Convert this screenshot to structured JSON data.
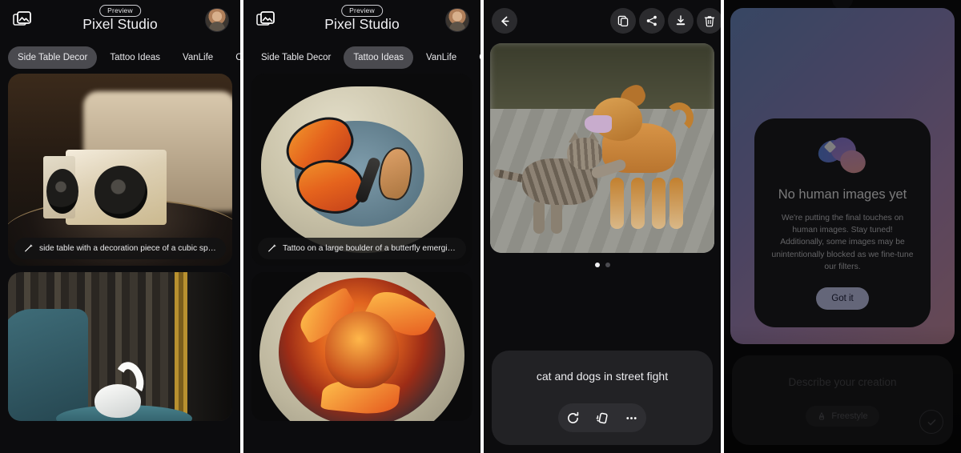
{
  "app": {
    "title": "Pixel Studio",
    "badge": "Preview",
    "gallery_icon": "gallery-folder-icon",
    "avatar": "user-avatar"
  },
  "tabs": [
    {
      "label": "Side Table Decor"
    },
    {
      "label": "Tattoo Ideas"
    },
    {
      "label": "VanLife"
    },
    {
      "label": "Cinema"
    }
  ],
  "panels": {
    "feed_side_table": {
      "active_tab": "Side Table Decor",
      "cards": [
        {
          "caption": "side table with a decoration piece of a cubic sp…",
          "icon": "magic-wand-icon"
        },
        {
          "caption": "",
          "icon": ""
        }
      ]
    },
    "feed_tattoo": {
      "active_tab": "Tattoo Ideas",
      "cards": [
        {
          "caption": "Tattoo on a large boulder of a butterfly emergin…",
          "icon": "magic-wand-icon"
        },
        {
          "caption": "",
          "icon": ""
        }
      ]
    },
    "detail": {
      "back_icon": "back-arrow-icon",
      "actions": [
        {
          "name": "copy-icon"
        },
        {
          "name": "share-icon"
        },
        {
          "name": "download-icon"
        },
        {
          "name": "delete-icon"
        }
      ],
      "pager": {
        "count": 2,
        "active": 0
      },
      "prompt": "cat and dogs in street fight",
      "prompt_actions": [
        {
          "name": "regenerate-icon"
        },
        {
          "name": "style-variation-icon"
        },
        {
          "name": "more-options-icon"
        }
      ]
    },
    "dialog_panel": {
      "dialog": {
        "logo": "pixel-studio-logo",
        "title": "No human images yet",
        "body": "We're putting the final touches on human images. Stay tuned! Additionally, some images may be unintentionally blocked as we fine-tune our filters.",
        "button": "Got it"
      },
      "composer": {
        "placeholder": "Describe your creation",
        "style_chip": "Freestyle",
        "style_chip_icon": "style-icon",
        "submit_icon": "check-icon"
      }
    }
  },
  "colors": {
    "background": "#0c0c0e",
    "surface": "#1d1d20",
    "accent": "#c9cdf2",
    "text_primary": "#f1f1f4",
    "text_secondary": "#c7c7cc"
  }
}
